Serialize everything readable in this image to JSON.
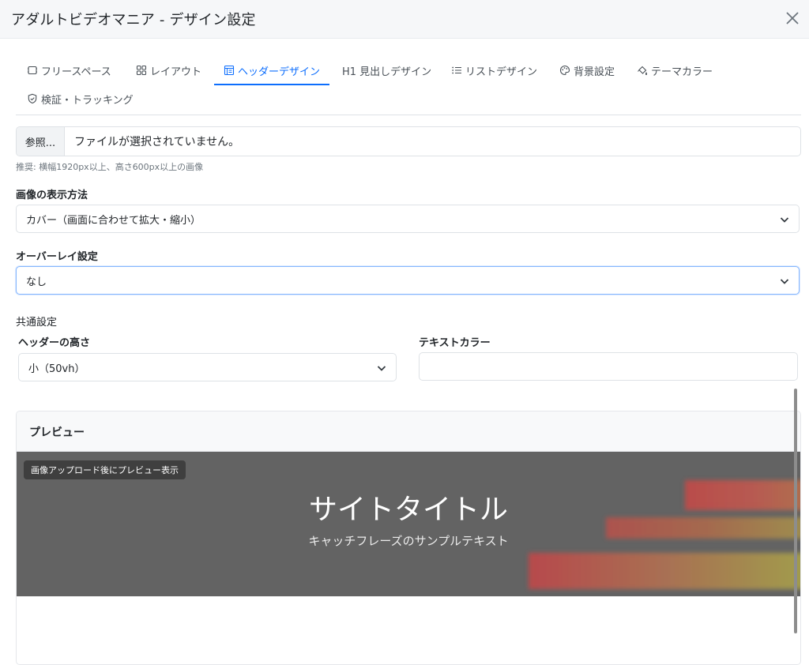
{
  "window": {
    "title": "アダルトビデオマニア - デザイン設定"
  },
  "tabs": [
    {
      "label": "フリースペース",
      "icon": "free-space-icon"
    },
    {
      "label": "レイアウト",
      "icon": "layout-grid-icon"
    },
    {
      "label": "ヘッダーデザイン",
      "icon": "header-layout-icon",
      "active": true
    },
    {
      "label": "H1 見出しデザイン",
      "icon": ""
    },
    {
      "label": "リストデザイン",
      "icon": "list-icon"
    },
    {
      "label": "背景設定",
      "icon": "palette-icon"
    },
    {
      "label": "テーマカラー",
      "icon": "paint-bucket-icon"
    },
    {
      "label": "検証・トラッキング",
      "icon": "shield-check-icon"
    }
  ],
  "file_upload": {
    "button_label": "参照...",
    "status_text": "ファイルが選択されていません。",
    "hint": "推奨: 横幅1920px以上、高さ600px以上の画像"
  },
  "display_method": {
    "label": "画像の表示方法",
    "value": "カバー（画面に合わせて拡大・縮小）"
  },
  "overlay": {
    "label": "オーバーレイ設定",
    "value": "なし"
  },
  "common": {
    "section_label": "共通設定",
    "height_label": "ヘッダーの高さ",
    "height_value": "小（50vh）",
    "text_color_label": "テキストカラー",
    "text_color_value": ""
  },
  "preview": {
    "title": "プレビュー",
    "badge": "画像アップロード後にプレビュー表示",
    "site_title": "サイトタイトル",
    "catchphrase": "キャッチフレーズのサンプルテキスト",
    "background_color": "#636363"
  },
  "colors": {
    "accent": "#0d6efd",
    "hero_stripe_red": "#c0504d",
    "hero_stripe_yellow": "#a8a24a"
  }
}
